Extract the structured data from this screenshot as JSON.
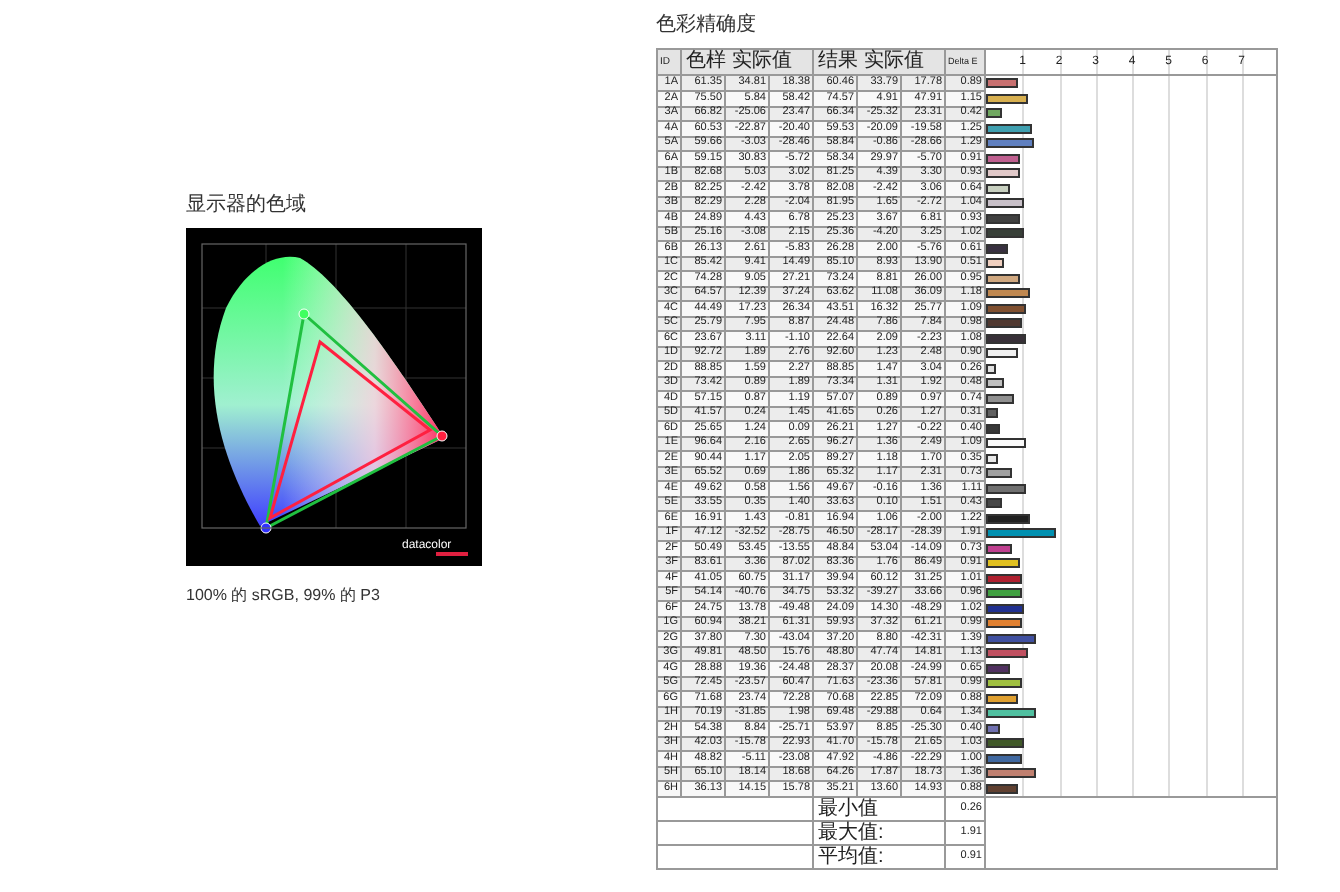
{
  "gamut": {
    "title": "显示器的色域",
    "logo": "datacolor",
    "caption": "100% 的 sRGB, 99% 的 P3"
  },
  "accuracy": {
    "title": "色彩精确度",
    "columns": [
      "ID",
      "色样 实际值",
      "结果 实际值",
      "Delta E"
    ],
    "scale_labels": [
      "1",
      "2",
      "3",
      "4",
      "5",
      "6",
      "7"
    ],
    "rows": [
      {
        "id": "1A",
        "sample": [
          "61.35",
          "34.81",
          "18.38"
        ],
        "result": [
          "60.46",
          "33.79",
          "17.78"
        ],
        "delta_e": "0.89",
        "color": "#c87070",
        "level": 0.111
      },
      {
        "id": "2A",
        "sample": [
          "75.50",
          "5.84",
          "58.42"
        ],
        "result": [
          "74.57",
          "4.91",
          "47.91"
        ],
        "delta_e": "1.15",
        "color": "#d8b050",
        "level": 0.144
      },
      {
        "id": "3A",
        "sample": [
          "66.82",
          "-25.06",
          "23.47"
        ],
        "result": [
          "66.34",
          "-25.32",
          "23.31"
        ],
        "delta_e": "0.42",
        "color": "#70a860",
        "level": 0.053
      },
      {
        "id": "4A",
        "sample": [
          "60.53",
          "-22.87",
          "-20.40"
        ],
        "result": [
          "59.53",
          "-20.09",
          "-19.58"
        ],
        "delta_e": "1.25",
        "color": "#40a0b0",
        "level": 0.156
      },
      {
        "id": "5A",
        "sample": [
          "59.66",
          "-3.03",
          "-28.46"
        ],
        "result": [
          "58.84",
          "-0.86",
          "-28.66"
        ],
        "delta_e": "1.29",
        "color": "#6080c0",
        "level": 0.161
      },
      {
        "id": "6A",
        "sample": [
          "59.15",
          "30.83",
          "-5.72"
        ],
        "result": [
          "58.34",
          "29.97",
          "-5.70"
        ],
        "delta_e": "0.91",
        "color": "#c06090",
        "level": 0.114
      },
      {
        "id": "1B",
        "sample": [
          "82.68",
          "5.03",
          "3.02"
        ],
        "result": [
          "81.25",
          "4.39",
          "3.30"
        ],
        "delta_e": "0.93",
        "color": "#e0c8c8",
        "level": 0.116
      },
      {
        "id": "2B",
        "sample": [
          "82.25",
          "-2.42",
          "3.78"
        ],
        "result": [
          "82.08",
          "-2.42",
          "3.06"
        ],
        "delta_e": "0.64",
        "color": "#c8d0c0",
        "level": 0.08
      },
      {
        "id": "3B",
        "sample": [
          "82.29",
          "2.28",
          "-2.04"
        ],
        "result": [
          "81.95",
          "1.65",
          "-2.72"
        ],
        "delta_e": "1.04",
        "color": "#c8c0c8",
        "level": 0.13
      },
      {
        "id": "4B",
        "sample": [
          "24.89",
          "4.43",
          "6.78"
        ],
        "result": [
          "25.23",
          "3.67",
          "6.81"
        ],
        "delta_e": "0.93",
        "color": "#404040",
        "level": 0.116
      },
      {
        "id": "5B",
        "sample": [
          "25.16",
          "-3.08",
          "2.15"
        ],
        "result": [
          "25.36",
          "-4.20",
          "3.25"
        ],
        "delta_e": "1.02",
        "color": "#384038",
        "level": 0.128
      },
      {
        "id": "6B",
        "sample": [
          "26.13",
          "2.61",
          "-5.83"
        ],
        "result": [
          "26.28",
          "2.00",
          "-5.76"
        ],
        "delta_e": "0.61",
        "color": "#383040",
        "level": 0.076
      },
      {
        "id": "1C",
        "sample": [
          "85.42",
          "9.41",
          "14.49"
        ],
        "result": [
          "85.10",
          "8.93",
          "13.90"
        ],
        "delta_e": "0.51",
        "color": "#f0d0c0",
        "level": 0.064
      },
      {
        "id": "2C",
        "sample": [
          "74.28",
          "9.05",
          "27.21"
        ],
        "result": [
          "73.24",
          "8.81",
          "26.00"
        ],
        "delta_e": "0.95",
        "color": "#d0a880",
        "level": 0.119
      },
      {
        "id": "3C",
        "sample": [
          "64.57",
          "12.39",
          "37.24"
        ],
        "result": [
          "63.62",
          "11.08",
          "36.09"
        ],
        "delta_e": "1.18",
        "color": "#c08850",
        "level": 0.148
      },
      {
        "id": "4C",
        "sample": [
          "44.49",
          "17.23",
          "26.34"
        ],
        "result": [
          "43.51",
          "16.32",
          "25.77"
        ],
        "delta_e": "1.09",
        "color": "#805030",
        "level": 0.136
      },
      {
        "id": "5C",
        "sample": [
          "25.79",
          "7.95",
          "8.87"
        ],
        "result": [
          "24.48",
          "7.86",
          "7.84"
        ],
        "delta_e": "0.98",
        "color": "#503830",
        "level": 0.123
      },
      {
        "id": "6C",
        "sample": [
          "23.67",
          "3.11",
          "-1.10"
        ],
        "result": [
          "22.64",
          "2.09",
          "-2.23"
        ],
        "delta_e": "1.08",
        "color": "#383038",
        "level": 0.135
      },
      {
        "id": "1D",
        "sample": [
          "92.72",
          "1.89",
          "2.76"
        ],
        "result": [
          "92.60",
          "1.23",
          "2.48"
        ],
        "delta_e": "0.90",
        "color": "#f0f0f0",
        "level": 0.113
      },
      {
        "id": "2D",
        "sample": [
          "88.85",
          "1.59",
          "2.27"
        ],
        "result": [
          "88.85",
          "1.47",
          "3.04"
        ],
        "delta_e": "0.26",
        "color": "#e0e0e0",
        "level": 0.033
      },
      {
        "id": "3D",
        "sample": [
          "73.42",
          "0.89",
          "1.89"
        ],
        "result": [
          "73.34",
          "1.31",
          "1.92"
        ],
        "delta_e": "0.48",
        "color": "#c0c0c0",
        "level": 0.06
      },
      {
        "id": "4D",
        "sample": [
          "57.15",
          "0.87",
          "1.19"
        ],
        "result": [
          "57.07",
          "0.89",
          "0.97"
        ],
        "delta_e": "0.74",
        "color": "#909090",
        "level": 0.093
      },
      {
        "id": "5D",
        "sample": [
          "41.57",
          "0.24",
          "1.45"
        ],
        "result": [
          "41.65",
          "0.26",
          "1.27"
        ],
        "delta_e": "0.31",
        "color": "#606060",
        "level": 0.039
      },
      {
        "id": "6D",
        "sample": [
          "25.65",
          "1.24",
          "0.09"
        ],
        "result": [
          "26.21",
          "1.27",
          "-0.22"
        ],
        "delta_e": "0.40",
        "color": "#383838",
        "level": 0.05
      },
      {
        "id": "1E",
        "sample": [
          "96.64",
          "2.16",
          "2.65"
        ],
        "result": [
          "96.27",
          "1.36",
          "2.49"
        ],
        "delta_e": "1.09",
        "color": "#fafafa",
        "level": 0.136
      },
      {
        "id": "2E",
        "sample": [
          "90.44",
          "1.17",
          "2.05"
        ],
        "result": [
          "89.27",
          "1.18",
          "1.70"
        ],
        "delta_e": "0.35",
        "color": "#e8e8e8",
        "level": 0.044
      },
      {
        "id": "3E",
        "sample": [
          "65.52",
          "0.69",
          "1.86"
        ],
        "result": [
          "65.32",
          "1.17",
          "2.31"
        ],
        "delta_e": "0.73",
        "color": "#a0a0a0",
        "level": 0.091
      },
      {
        "id": "4E",
        "sample": [
          "49.62",
          "0.58",
          "1.56"
        ],
        "result": [
          "49.67",
          "-0.16",
          "1.36"
        ],
        "delta_e": "1.11",
        "color": "#707070",
        "level": 0.139
      },
      {
        "id": "5E",
        "sample": [
          "33.55",
          "0.35",
          "1.40"
        ],
        "result": [
          "33.63",
          "0.10",
          "1.51"
        ],
        "delta_e": "0.43",
        "color": "#484848",
        "level": 0.054
      },
      {
        "id": "6E",
        "sample": [
          "16.91",
          "1.43",
          "-0.81"
        ],
        "result": [
          "16.94",
          "1.06",
          "-2.00"
        ],
        "delta_e": "1.22",
        "color": "#202020",
        "level": 0.153
      },
      {
        "id": "1F",
        "sample": [
          "47.12",
          "-32.52",
          "-28.75"
        ],
        "result": [
          "46.50",
          "-28.17",
          "-28.39"
        ],
        "delta_e": "1.91",
        "color": "#0090b0",
        "level": 0.239
      },
      {
        "id": "2F",
        "sample": [
          "50.49",
          "53.45",
          "-13.55"
        ],
        "result": [
          "48.84",
          "53.04",
          "-14.09"
        ],
        "delta_e": "0.73",
        "color": "#c04090",
        "level": 0.091
      },
      {
        "id": "3F",
        "sample": [
          "83.61",
          "3.36",
          "87.02"
        ],
        "result": [
          "83.36",
          "1.76",
          "86.49"
        ],
        "delta_e": "0.91",
        "color": "#e0c020",
        "level": 0.114
      },
      {
        "id": "4F",
        "sample": [
          "41.05",
          "60.75",
          "31.17"
        ],
        "result": [
          "39.94",
          "60.12",
          "31.25"
        ],
        "delta_e": "1.01",
        "color": "#b02030",
        "level": 0.126
      },
      {
        "id": "5F",
        "sample": [
          "54.14",
          "-40.76",
          "34.75"
        ],
        "result": [
          "53.32",
          "-39.27",
          "33.66"
        ],
        "delta_e": "0.96",
        "color": "#40a040",
        "level": 0.12
      },
      {
        "id": "6F",
        "sample": [
          "24.75",
          "13.78",
          "-49.48"
        ],
        "result": [
          "24.09",
          "14.30",
          "-48.29"
        ],
        "delta_e": "1.02",
        "color": "#203090",
        "level": 0.128
      },
      {
        "id": "1G",
        "sample": [
          "60.94",
          "38.21",
          "61.31"
        ],
        "result": [
          "59.93",
          "37.32",
          "61.21"
        ],
        "delta_e": "0.99",
        "color": "#e08030",
        "level": 0.124
      },
      {
        "id": "2G",
        "sample": [
          "37.80",
          "7.30",
          "-43.04"
        ],
        "result": [
          "37.20",
          "8.80",
          "-42.31"
        ],
        "delta_e": "1.39",
        "color": "#4050a0",
        "level": 0.174
      },
      {
        "id": "3G",
        "sample": [
          "49.81",
          "48.50",
          "15.76"
        ],
        "result": [
          "48.80",
          "47.74",
          "14.81"
        ],
        "delta_e": "1.13",
        "color": "#c05060",
        "level": 0.141
      },
      {
        "id": "4G",
        "sample": [
          "28.88",
          "19.36",
          "-24.48"
        ],
        "result": [
          "28.37",
          "20.08",
          "-24.99"
        ],
        "delta_e": "0.65",
        "color": "#503060",
        "level": 0.081
      },
      {
        "id": "5G",
        "sample": [
          "72.45",
          "-23.57",
          "60.47"
        ],
        "result": [
          "71.63",
          "-23.36",
          "57.81"
        ],
        "delta_e": "0.99",
        "color": "#a0c040",
        "level": 0.124
      },
      {
        "id": "6G",
        "sample": [
          "71.68",
          "23.74",
          "72.28"
        ],
        "result": [
          "70.68",
          "22.85",
          "72.09"
        ],
        "delta_e": "0.88",
        "color": "#e0a030",
        "level": 0.11
      },
      {
        "id": "1H",
        "sample": [
          "70.19",
          "-31.85",
          "1.98"
        ],
        "result": [
          "69.48",
          "-29.88",
          "0.64"
        ],
        "delta_e": "1.34",
        "color": "#50c0a0",
        "level": 0.168
      },
      {
        "id": "2H",
        "sample": [
          "54.38",
          "8.84",
          "-25.71"
        ],
        "result": [
          "53.97",
          "8.85",
          "-25.30"
        ],
        "delta_e": "0.40",
        "color": "#7070b0",
        "level": 0.05
      },
      {
        "id": "3H",
        "sample": [
          "42.03",
          "-15.78",
          "22.93"
        ],
        "result": [
          "41.70",
          "-15.78",
          "21.65"
        ],
        "delta_e": "1.03",
        "color": "#405828",
        "level": 0.129
      },
      {
        "id": "4H",
        "sample": [
          "48.82",
          "-5.11",
          "-23.08"
        ],
        "result": [
          "47.92",
          "-4.86",
          "-22.29"
        ],
        "delta_e": "1.00",
        "color": "#4068a0",
        "level": 0.125
      },
      {
        "id": "5H",
        "sample": [
          "65.10",
          "18.14",
          "18.68"
        ],
        "result": [
          "64.26",
          "17.87",
          "18.73"
        ],
        "delta_e": "1.36",
        "color": "#c08070",
        "level": 0.17
      },
      {
        "id": "6H",
        "sample": [
          "36.13",
          "14.15",
          "15.78"
        ],
        "result": [
          "35.21",
          "13.60",
          "14.93"
        ],
        "delta_e": "0.88",
        "color": "#604030",
        "level": 0.11
      }
    ],
    "summary": [
      {
        "label": "最小值",
        "value": "0.26"
      },
      {
        "label": "最大值:",
        "value": "1.91"
      },
      {
        "label": "平均值:",
        "value": "0.91"
      }
    ]
  }
}
